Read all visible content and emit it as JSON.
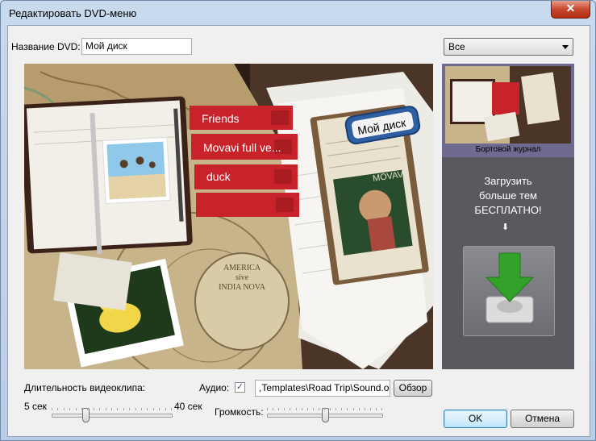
{
  "window": {
    "title": "Редактировать DVD-меню",
    "close_glyph": "✕"
  },
  "dvd_name": {
    "label": "Название DVD:",
    "value": "Мой диск"
  },
  "theme_filter": {
    "selected": "Все"
  },
  "preview": {
    "menu_items": [
      "Friends",
      "Movavi full ve...",
      "duck",
      ""
    ],
    "disc_tag": "Мой диск",
    "map_text": [
      "AMERICA",
      "sive",
      "INDIA NOVA"
    ],
    "book_text": "MOVAVI"
  },
  "themes": {
    "items": [
      {
        "name": "Бортовой журнал",
        "selected": true
      }
    ],
    "promo_text": [
      "Загрузить",
      "больше тем",
      "БЕСПЛАТНО!"
    ],
    "promo_arrow": "⬇"
  },
  "clip_duration": {
    "label": "Длительность видеоклипа:",
    "min_label": "5 сек",
    "max_label": "40 сек",
    "value_fraction": 0.27
  },
  "audio": {
    "label": "Аудио:",
    "checked": true,
    "check_glyph": "✓",
    "path": ",Templates\\Road Trip\\Sound.ogg",
    "browse_label": "Обзор"
  },
  "volume": {
    "label": "Громкость:",
    "value_fraction": 0.5
  },
  "buttons": {
    "ok": "OK",
    "cancel": "Отмена"
  }
}
